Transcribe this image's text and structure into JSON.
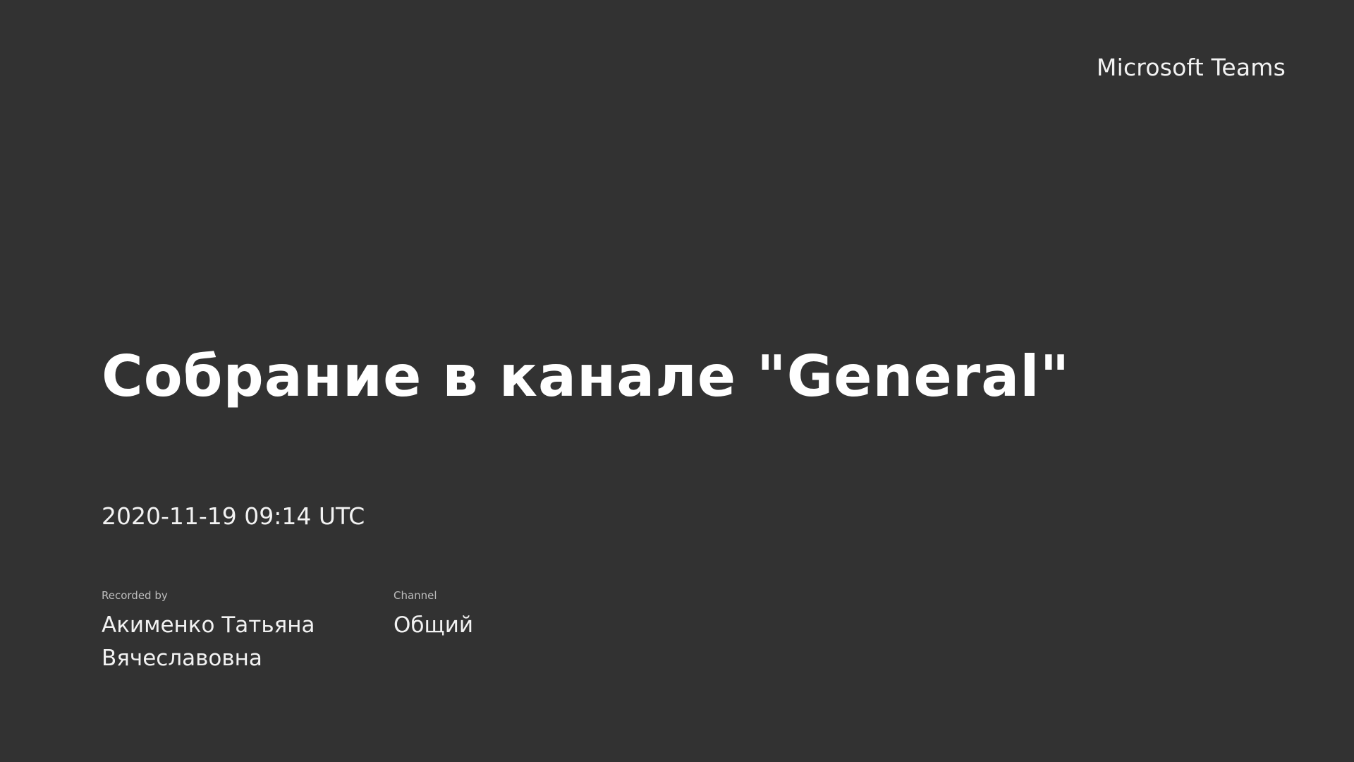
{
  "brand": "Microsoft Teams",
  "meeting": {
    "title": "Собрание в канале \"General\"",
    "datetime": "2020-11-19 09:14 UTC"
  },
  "details": {
    "recorded_by_label": "Recorded by",
    "recorded_by_value": "Акименко Татьяна Вячеславовна",
    "channel_label": "Channel",
    "channel_value": "Общий"
  },
  "colors": {
    "background": "#323232",
    "text": "#ffffff"
  }
}
